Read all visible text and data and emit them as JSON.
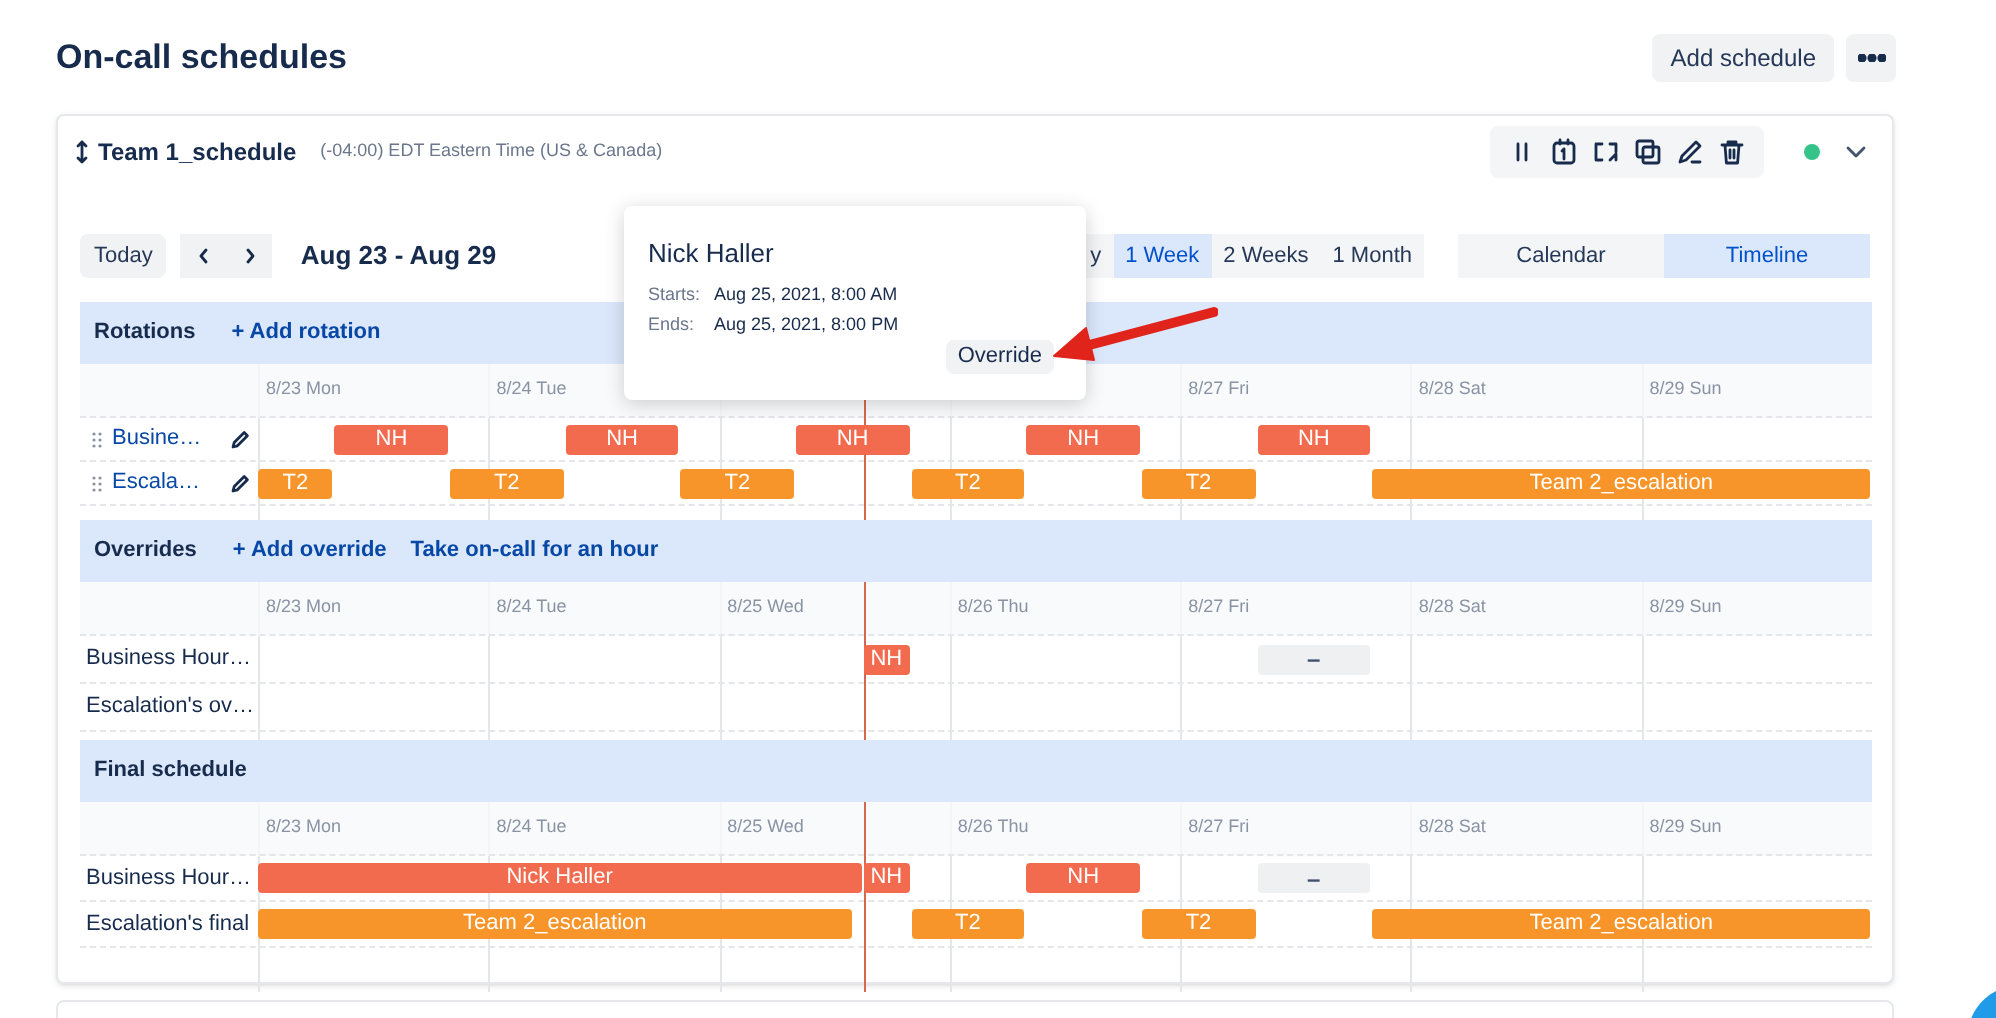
{
  "page_title": "On-call schedules",
  "add_button": "Add schedule",
  "schedule": {
    "name": "Team 1_schedule",
    "timezone": "(-04:00) EDT Eastern Time (US & Canada)",
    "enabled": true
  },
  "toolbar": {
    "today": "Today",
    "date_range": "Aug 23 - Aug 29",
    "ranges": [
      {
        "label": "y",
        "selected": false
      },
      {
        "label": "1 Week",
        "selected": true
      },
      {
        "label": "2 Weeks",
        "selected": false
      },
      {
        "label": "1 Month",
        "selected": false
      }
    ],
    "views": [
      {
        "label": "Calendar",
        "selected": false
      },
      {
        "label": "Timeline",
        "selected": true
      }
    ]
  },
  "sections": [
    {
      "title": "Rotations",
      "actions": [
        "+ Add rotation"
      ],
      "days": [
        "8/23 Mon",
        "8/24 Tue",
        "8/27 Fri",
        "8/28 Sat",
        "8/29 Sun"
      ],
      "rows": [
        {
          "kind": "rotation",
          "label": "Busine…",
          "bars": [
            {
              "kind": "shift",
              "label": "NH",
              "color": "#f26b4f"
            },
            {
              "kind": "shift",
              "label": "NH",
              "color": "#f26b4f"
            },
            {
              "kind": "shift",
              "label": "NH",
              "color": "#f26b4f"
            },
            {
              "kind": "shift",
              "label": "NH",
              "color": "#f26b4f"
            },
            {
              "kind": "shift",
              "label": "NH",
              "color": "#f26b4f"
            }
          ]
        },
        {
          "kind": "rotation",
          "label": "Escala…",
          "bars": [
            {
              "kind": "shift",
              "label": "T2",
              "color": "#f7952a"
            },
            {
              "kind": "shift",
              "label": "T2",
              "color": "#f7952a"
            },
            {
              "kind": "shift",
              "label": "T2",
              "color": "#f7952a"
            },
            {
              "kind": "shift",
              "label": "T2",
              "color": "#f7952a"
            },
            {
              "kind": "shift",
              "label": "T2",
              "color": "#f7952a"
            },
            {
              "kind": "shift",
              "label": "Team 2_escalation",
              "color": "#f7952a"
            }
          ]
        }
      ]
    },
    {
      "title": "Overrides",
      "actions": [
        "+ Add override",
        "Take on-call for an hour"
      ],
      "days": [
        "8/23 Mon",
        "8/24 Tue",
        "8/25 Wed",
        "8/26 Thu",
        "8/27 Fri",
        "8/28 Sat",
        "8/29 Sun"
      ],
      "rows": [
        {
          "kind": "plain",
          "label": "Business Hour…",
          "bars": [
            {
              "kind": "shift",
              "label": "NH",
              "color": "#f26b4f"
            },
            {
              "kind": "gap",
              "label": "–"
            }
          ]
        },
        {
          "kind": "plain",
          "label": "Escalation's ov…"
        }
      ]
    },
    {
      "title": "Final schedule",
      "days": [
        "8/23 Mon",
        "8/24 Tue",
        "8/25 Wed",
        "8/26 Thu",
        "8/27 Fri",
        "8/28 Sat",
        "8/29 Sun"
      ],
      "rows": [
        {
          "kind": "plain",
          "label": "Business Hour…",
          "bars": [
            {
              "kind": "shift",
              "label": "Nick Haller",
              "color": "#f26b4f"
            },
            {
              "kind": "shift",
              "label": "NH",
              "color": "#f26b4f"
            },
            {
              "kind": "shift",
              "label": "NH",
              "color": "#f26b4f"
            },
            {
              "kind": "gap",
              "label": "–"
            }
          ]
        },
        {
          "kind": "plain",
          "label": "Escalation's final",
          "bars": [
            {
              "kind": "shift",
              "label": "Team 2_escalation",
              "color": "#f7952a"
            },
            {
              "kind": "shift",
              "label": "T2",
              "color": "#f7952a"
            },
            {
              "kind": "shift",
              "label": "T2",
              "color": "#f7952a"
            },
            {
              "kind": "shift",
              "label": "Team 2_escalation",
              "color": "#f7952a"
            }
          ]
        }
      ]
    }
  ],
  "popover": {
    "title": "Nick Haller",
    "fields": [
      {
        "label": "Starts:",
        "value": "Aug 25, 2021, 8:00 AM"
      },
      {
        "label": "Ends:",
        "value": "Aug 25, 2021, 8:00 PM"
      }
    ],
    "button": "Override"
  }
}
